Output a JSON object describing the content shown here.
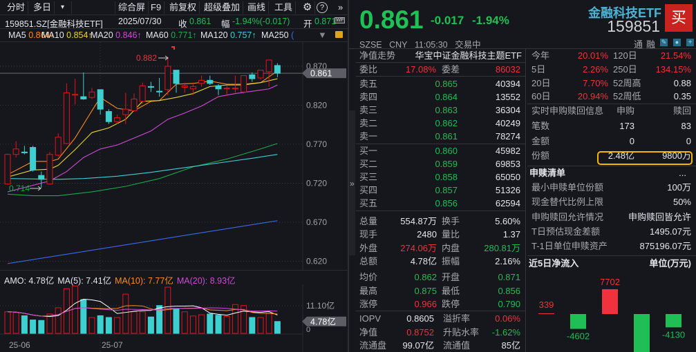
{
  "toolbar": {
    "items": [
      "分时",
      "多日",
      "综合屏",
      "F9",
      "前复权",
      "超级叠加",
      "画线",
      "工具"
    ],
    "dropdown_icon": "caret-down-icon",
    "settings_icon": "gear-icon",
    "help_icon": "question-icon",
    "more_icon": "double-chevron-right-icon"
  },
  "info": {
    "symbol": "159851.SZ[金融科技ETF]",
    "date": "2025/07/30",
    "close_label": "收",
    "close": "0.861",
    "change_label": "幅",
    "change": "-1.94%(-0.017)",
    "open_label": "开",
    "open": "0.871",
    "badge": "WP"
  },
  "ma_legend": [
    {
      "label": "MA5",
      "value": "0.864↑",
      "color": "#ff8c1a"
    },
    {
      "label": "MA10",
      "value": "0.854↑",
      "color": "#e8d630"
    },
    {
      "label": "MA20",
      "value": "0.846↑",
      "color": "#d04ad8"
    },
    {
      "label": "MA60",
      "value": "0.771↑",
      "color": "#1fa84a"
    },
    {
      "label": "MA120",
      "value": "0.757↑",
      "color": "#3ecfd8"
    },
    {
      "label": "MA250",
      "value": "(",
      "color": "#3a6cf0"
    }
  ],
  "chart_data": [
    {
      "type": "candlestick",
      "yticks": [
        "0.870",
        "0.820",
        "0.770",
        "0.720",
        "0.670",
        "0.620"
      ],
      "ylim": [
        0.615,
        0.89
      ],
      "current_price": "0.861",
      "high_marker": "0.882",
      "low_marker": "0.714",
      "up_color": "#e5121c",
      "down_color": "#3ecfd0",
      "ohlc": [
        [
          0.719,
          0.758,
          0.719,
          0.757
        ],
        [
          0.757,
          0.774,
          0.753,
          0.764
        ],
        [
          0.76,
          0.768,
          0.757,
          0.759
        ],
        [
          0.766,
          0.768,
          0.735,
          0.737
        ],
        [
          0.73,
          0.735,
          0.714,
          0.725
        ],
        [
          0.719,
          0.76,
          0.719,
          0.757
        ],
        [
          0.756,
          0.784,
          0.754,
          0.779
        ],
        [
          0.771,
          0.848,
          0.771,
          0.836
        ],
        [
          0.833,
          0.854,
          0.821,
          0.834
        ],
        [
          0.831,
          0.862,
          0.827,
          0.828
        ],
        [
          0.83,
          0.842,
          0.828,
          0.837
        ],
        [
          0.84,
          0.84,
          0.808,
          0.815
        ],
        [
          0.812,
          0.815,
          0.796,
          0.799
        ],
        [
          0.799,
          0.808,
          0.796,
          0.804
        ],
        [
          0.808,
          0.836,
          0.796,
          0.815
        ],
        [
          0.813,
          0.835,
          0.813,
          0.828
        ],
        [
          0.825,
          0.849,
          0.822,
          0.845
        ],
        [
          0.844,
          0.85,
          0.837,
          0.843
        ],
        [
          0.838,
          0.855,
          0.831,
          0.837
        ],
        [
          0.84,
          0.882,
          0.833,
          0.87
        ],
        [
          0.865,
          0.865,
          0.836,
          0.848
        ],
        [
          0.843,
          0.849,
          0.836,
          0.845
        ],
        [
          0.841,
          0.847,
          0.833,
          0.844
        ],
        [
          0.848,
          0.858,
          0.844,
          0.852
        ],
        [
          0.852,
          0.858,
          0.846,
          0.848
        ],
        [
          0.845,
          0.847,
          0.833,
          0.841
        ],
        [
          0.841,
          0.845,
          0.832,
          0.842
        ],
        [
          0.841,
          0.858,
          0.836,
          0.842
        ],
        [
          0.837,
          0.858,
          0.835,
          0.858
        ],
        [
          0.859,
          0.862,
          0.85,
          0.854
        ],
        [
          0.855,
          0.865,
          0.853,
          0.865
        ],
        [
          0.863,
          0.878,
          0.844,
          0.878
        ],
        [
          0.871,
          0.874,
          0.856,
          0.861
        ]
      ],
      "ma_lines": [
        {
          "name": "MA5",
          "color": "#ff8c1a",
          "points": [
            [
              0,
              0.731
            ],
            [
              3,
              0.748
            ],
            [
              5,
              0.748
            ],
            [
              6,
              0.751
            ],
            [
              8,
              0.778
            ],
            [
              10,
              0.813
            ],
            [
              11,
              0.83
            ],
            [
              13,
              0.816
            ],
            [
              15,
              0.813
            ],
            [
              17,
              0.825
            ],
            [
              18,
              0.826
            ],
            [
              20,
              0.847
            ],
            [
              22,
              0.848
            ],
            [
              24,
              0.851
            ],
            [
              26,
              0.847
            ],
            [
              28,
              0.847
            ],
            [
              30,
              0.849
            ],
            [
              32,
              0.864
            ]
          ]
        },
        {
          "name": "MA10",
          "color": "#e8d630",
          "points": [
            [
              0,
              0.728
            ],
            [
              3,
              0.737
            ],
            [
              5,
              0.738
            ],
            [
              6,
              0.743
            ],
            [
              8,
              0.763
            ],
            [
              10,
              0.785
            ],
            [
              12,
              0.791
            ],
            [
              14,
              0.802
            ],
            [
              16,
              0.825
            ],
            [
              18,
              0.826
            ],
            [
              20,
              0.83
            ],
            [
              22,
              0.835
            ],
            [
              24,
              0.844
            ],
            [
              26,
              0.846
            ],
            [
              28,
              0.846
            ],
            [
              30,
              0.849
            ],
            [
              32,
              0.854
            ]
          ]
        },
        {
          "name": "MA20",
          "color": "#d04ad8",
          "points": [
            [
              0,
              0.709
            ],
            [
              5,
              0.723
            ],
            [
              7,
              0.735
            ],
            [
              9,
              0.753
            ],
            [
              11,
              0.764
            ],
            [
              13,
              0.769
            ],
            [
              15,
              0.778
            ],
            [
              17,
              0.787
            ],
            [
              19,
              0.802
            ],
            [
              21,
              0.81
            ],
            [
              23,
              0.819
            ],
            [
              25,
              0.831
            ],
            [
              27,
              0.835
            ],
            [
              29,
              0.838
            ],
            [
              31,
              0.841
            ],
            [
              32,
              0.846
            ]
          ]
        },
        {
          "name": "MA60",
          "color": "#1fa84a",
          "points": [
            [
              0,
              0.706
            ],
            [
              3,
              0.704
            ],
            [
              6,
              0.704
            ],
            [
              10,
              0.709
            ],
            [
              14,
              0.716
            ],
            [
              18,
              0.726
            ],
            [
              22,
              0.741
            ],
            [
              26,
              0.751
            ],
            [
              30,
              0.764
            ],
            [
              32,
              0.771
            ]
          ]
        },
        {
          "name": "MA120",
          "color": "#3ecfd8",
          "points": [
            [
              0,
              0.726
            ],
            [
              6,
              0.725
            ],
            [
              9,
              0.726
            ],
            [
              13,
              0.729
            ],
            [
              17,
              0.734
            ],
            [
              21,
              0.74
            ],
            [
              25,
              0.746
            ],
            [
              29,
              0.752
            ],
            [
              32,
              0.757
            ]
          ]
        },
        {
          "name": "MA250",
          "color": "#3a6cf0",
          "points": [
            [
              0,
              0.617
            ],
            [
              32,
              0.672
            ]
          ]
        }
      ]
    },
    {
      "type": "bar",
      "legend": [
        {
          "text": "AMO: 4.78亿",
          "color": "#e6e6ea"
        },
        {
          "text": "MA(5): 7.41亿",
          "color": "#e6e6ea"
        },
        {
          "text": "MA(10): 7.77亿",
          "color": "#ff8c1a"
        },
        {
          "text": "MA(20): 8.93亿",
          "color": "#d04ad8"
        }
      ],
      "unit": "亿",
      "ytick": "11.10亿",
      "ytick_zero": "0",
      "current_label": "4.78亿",
      "xticks": [
        "25-06",
        "25-07"
      ],
      "values": [
        8.7,
        8.4,
        7.1,
        5.4,
        5.2,
        7.8,
        10.3,
        18.0,
        19.1,
        13.6,
        6.4,
        7.1,
        6.4,
        6.4,
        15.8,
        8.7,
        8.7,
        6.6,
        11.2,
        18.6,
        9.8,
        8.7,
        7.0,
        7.5,
        7.8,
        7.3,
        6.8,
        11.6,
        11.2,
        6.4,
        6.4,
        8.1,
        4.78
      ]
    },
    {
      "type": "bar",
      "title": "近5日净流入",
      "unit_label": "单位(万元)",
      "values": [
        339,
        -4602,
        7702,
        -12000,
        -4130
      ],
      "labels": [
        "339",
        "-4602",
        "7702",
        "",
        "-4130"
      ],
      "up_color": "#f0323c",
      "down_color": "#1fbf55"
    }
  ],
  "quote": {
    "price": "0.861",
    "change": "-0.017",
    "change_pct": "-1.94%",
    "name": "金融科技ETF",
    "code": "159851",
    "buy_button": "买",
    "exchange": "SZSE",
    "currency": "CNY",
    "time": "11:05:30",
    "status": "交易中",
    "tags": [
      "通",
      "融"
    ],
    "icons": [
      "pencil-icon",
      "bell-icon",
      "plus-icon"
    ]
  },
  "book": {
    "nav_trend_label": "净值走势",
    "fund_name": "华宝中证金融科技主题ETF",
    "ratio": {
      "l1": "委比",
      "v1": "17.08%",
      "c1": "red",
      "l2": "委差",
      "v2": "86032",
      "c2": "red"
    },
    "asks": [
      {
        "label": "卖五",
        "price": "0.865",
        "vol": "40394"
      },
      {
        "label": "卖四",
        "price": "0.864",
        "vol": "13552"
      },
      {
        "label": "卖三",
        "price": "0.863",
        "vol": "36304"
      },
      {
        "label": "卖二",
        "price": "0.862",
        "vol": "40249"
      },
      {
        "label": "卖一",
        "price": "0.861",
        "vol": "78274"
      }
    ],
    "bids": [
      {
        "label": "买一",
        "price": "0.860",
        "vol": "45982"
      },
      {
        "label": "买二",
        "price": "0.859",
        "vol": "69853"
      },
      {
        "label": "买三",
        "price": "0.858",
        "vol": "65050"
      },
      {
        "label": "买四",
        "price": "0.857",
        "vol": "51326"
      },
      {
        "label": "买五",
        "price": "0.856",
        "vol": "62594"
      }
    ],
    "stats": [
      {
        "l1": "总量",
        "v1": "554.87万",
        "c1": "white",
        "l2": "换手",
        "v2": "5.60%",
        "c2": "white"
      },
      {
        "l1": "现手",
        "v1": "2480",
        "c1": "white",
        "l2": "量比",
        "v2": "1.37",
        "c2": "white"
      },
      {
        "l1": "外盘",
        "v1": "274.06万",
        "c1": "red",
        "l2": "内盘",
        "v2": "280.81万",
        "c2": "green"
      },
      {
        "l1": "总额",
        "v1": "4.78亿",
        "c1": "white",
        "l2": "振幅",
        "v2": "2.16%",
        "c2": "white"
      },
      {
        "l1": "均价",
        "v1": "0.862",
        "c1": "green",
        "l2": "开盘",
        "v2": "0.871",
        "c2": "green"
      },
      {
        "l1": "最高",
        "v1": "0.875",
        "c1": "green",
        "l2": "最低",
        "v2": "0.856",
        "c2": "green"
      },
      {
        "l1": "涨停",
        "v1": "0.966",
        "c1": "red",
        "l2": "跌停",
        "v2": "0.790",
        "c2": "green"
      }
    ],
    "fund": [
      {
        "l1": "IOPV",
        "v1": "0.8605",
        "c1": "white",
        "l2": "溢折率",
        "v2": "0.06%",
        "c2": "red"
      },
      {
        "l1": "净值",
        "v1": "0.8752",
        "c1": "red",
        "l2": "升贴水率",
        "v2": "-1.62%",
        "c2": "green"
      },
      {
        "l1": "流通盘",
        "v1": "99.07亿",
        "c1": "white",
        "l2": "流通值",
        "v2": "85亿",
        "c2": "white"
      }
    ],
    "expand_icon": "»"
  },
  "perf": [
    {
      "l1": "今年",
      "v1": "20.01%",
      "c1": "red",
      "l2": "120日",
      "v2": "21.54%",
      "c2": "red"
    },
    {
      "l1": "5日",
      "v1": "2.26%",
      "c1": "red",
      "l2": "250日",
      "v2": "134.15%",
      "c2": "red"
    },
    {
      "l1": "20日",
      "v1": "7.70%",
      "c1": "red",
      "l2": "52周高",
      "v2": "0.88",
      "c2": "white"
    },
    {
      "l1": "60日",
      "v1": "20.94%",
      "c1": "red",
      "l2": "52周低",
      "v2": "0.35",
      "c2": "white"
    }
  ],
  "creation": {
    "title": "实时申购赎回信息",
    "col1": "申购",
    "col2": "赎回",
    "rows": [
      {
        "label": "笔数",
        "v1": "173",
        "v2": "83"
      },
      {
        "label": "金额",
        "v1": "0",
        "v2": "0"
      },
      {
        "label": "份额",
        "v1": "2.48亿",
        "v2": "9800万"
      }
    ],
    "highlight_color": "#f5b800"
  },
  "pcf": {
    "title": "申赎清单",
    "more": "...",
    "rows": [
      {
        "label": "最小申赎单位份额",
        "value": "100万"
      },
      {
        "label": "现金替代比例上限",
        "value": "50%"
      },
      {
        "label": "申购赎回允许情况",
        "value": "申购赎回皆允许"
      },
      {
        "label": "T日预估现金差额",
        "value": "1495.07元"
      },
      {
        "label": "T-1日单位申赎资产",
        "value": "875196.07元"
      }
    ]
  }
}
